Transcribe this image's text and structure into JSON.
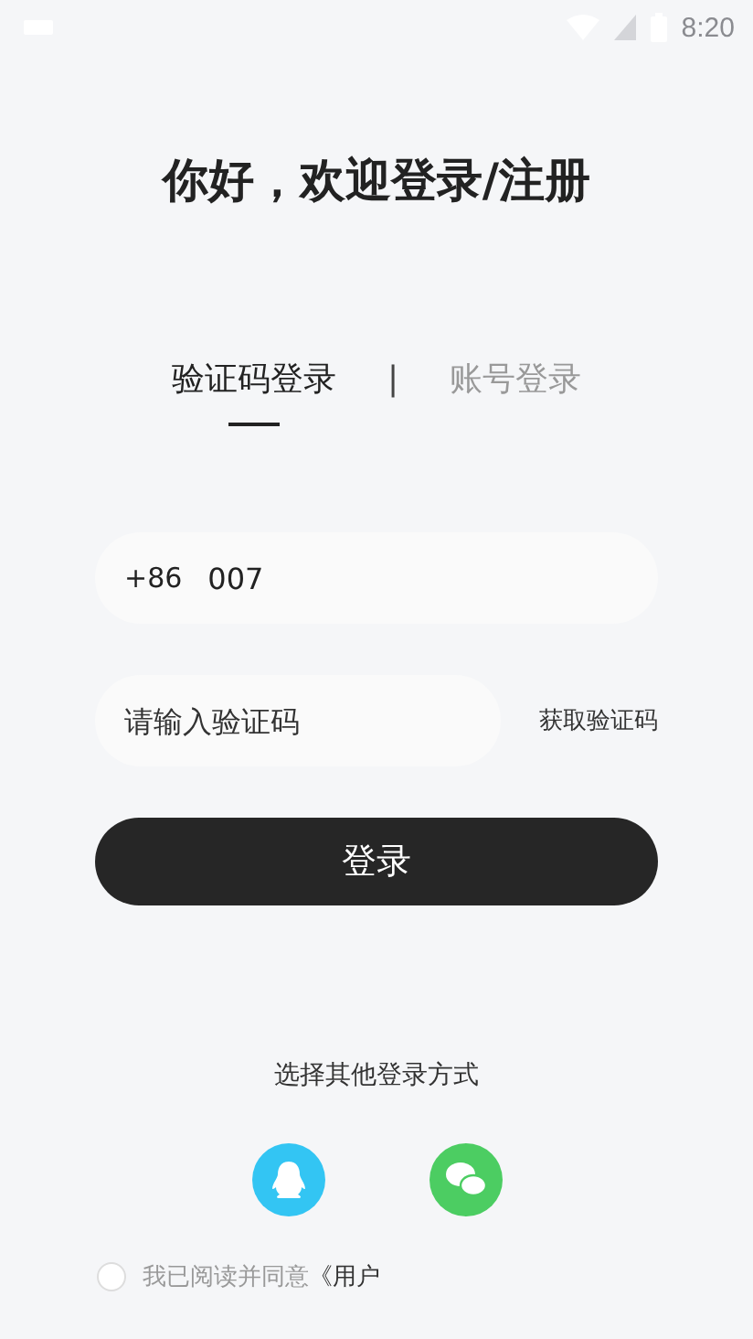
{
  "status_bar": {
    "time": "8:20"
  },
  "title": "你好，欢迎登录/注册",
  "tabs": [
    {
      "label": "验证码登录",
      "selected": true
    },
    {
      "label": "账号登录",
      "selected": false
    }
  ],
  "tab_separator": "|",
  "phone": {
    "prefix": "+86",
    "value": "007"
  },
  "code": {
    "placeholder": "请输入验证码",
    "get_code": "获取验证码"
  },
  "login_button": "登录",
  "other_methods": {
    "label": "选择其他登录方式",
    "methods": [
      {
        "kind": "qq"
      },
      {
        "kind": "wechat"
      }
    ]
  },
  "agreement": {
    "checked": false,
    "text": "我已阅读并同意",
    "link": "《用户"
  }
}
